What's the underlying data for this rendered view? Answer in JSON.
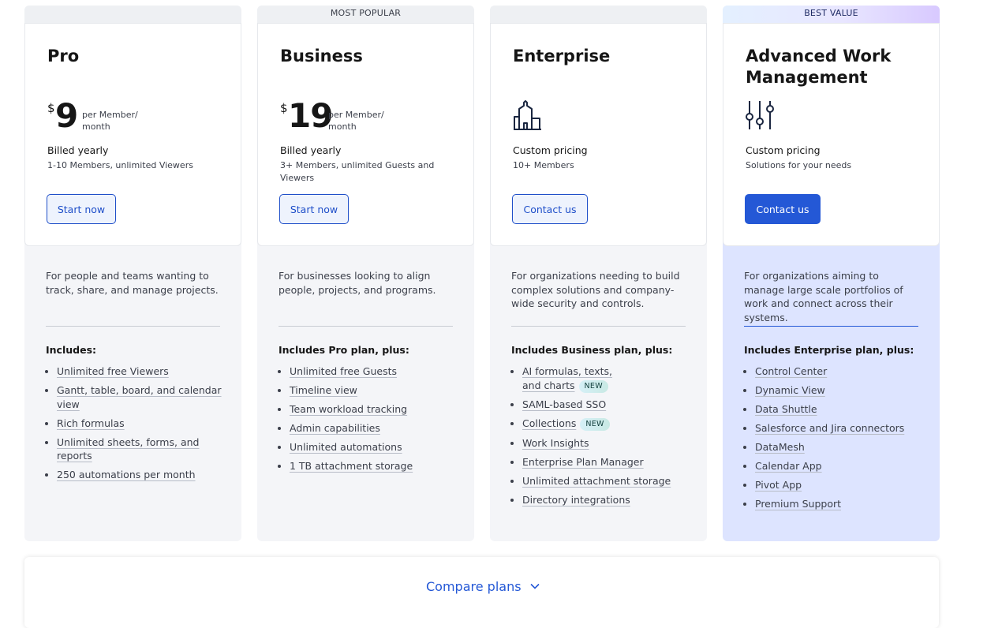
{
  "plans": [
    {
      "banner": "",
      "title": "Pro",
      "price": {
        "currency": "$",
        "amount": "9",
        "per": "per Member/ month"
      },
      "billing": "Billed yearly",
      "subtext": "1-10 Members, unlimited Viewers",
      "cta": "Start now",
      "description": "For people and teams wanting to track, share, and manage projects.",
      "includes_label": "Includes:",
      "features": [
        {
          "text": "Unlimited free Viewers"
        },
        {
          "text": "Gantt, table, board, and calendar view"
        },
        {
          "text": "Rich formulas"
        },
        {
          "text": "Unlimited sheets, forms, and reports"
        },
        {
          "text": "250 automations per month"
        }
      ]
    },
    {
      "banner": "MOST POPULAR",
      "title": "Business",
      "price": {
        "currency": "$",
        "amount": "19",
        "per": "per Member/ month"
      },
      "billing": "Billed yearly",
      "subtext": "3+ Members, unlimited Guests and Viewers",
      "cta": "Start now",
      "description": "For businesses looking to align people, projects, and programs.",
      "includes_label": "Includes Pro plan, plus:",
      "features": [
        {
          "text": "Unlimited free Guests"
        },
        {
          "text": "Timeline view"
        },
        {
          "text": "Team workload tracking"
        },
        {
          "text": "Admin capabilities"
        },
        {
          "text": "Unlimited automations"
        },
        {
          "text": "1 TB attachment storage"
        }
      ]
    },
    {
      "banner": "",
      "title": "Enterprise",
      "icon": "building-icon",
      "billing": "Custom pricing",
      "subtext": "10+ Members",
      "cta": "Contact us",
      "description": "For organizations needing to build complex solutions and company-wide security and controls.",
      "includes_label": "Includes Business plan, plus:",
      "features": [
        {
          "text": "AI formulas, texts, and charts",
          "badge": "NEW"
        },
        {
          "text": "SAML-based SSO"
        },
        {
          "text": "Collections",
          "badge": "NEW"
        },
        {
          "text": "Work Insights"
        },
        {
          "text": "Enterprise Plan Manager"
        },
        {
          "text": "Unlimited attachment storage"
        },
        {
          "text": "Directory integrations"
        }
      ]
    },
    {
      "banner": "BEST VALUE",
      "title": "Advanced Work Management",
      "icon": "sliders-icon",
      "billing": "Custom pricing",
      "subtext": "Solutions for your needs",
      "cta": "Contact us",
      "description": "For organizations aiming to manage large scale portfolios of work and connect across their systems.",
      "includes_label": "Includes Enterprise plan, plus:",
      "features": [
        {
          "text": "Control Center"
        },
        {
          "text": "Dynamic View"
        },
        {
          "text": "Data Shuttle"
        },
        {
          "text": "Salesforce and Jira connectors"
        },
        {
          "text": "DataMesh"
        },
        {
          "text": "Calendar App"
        },
        {
          "text": "Pivot App"
        },
        {
          "text": "Premium Support"
        }
      ]
    }
  ],
  "compare": {
    "label": "Compare plans",
    "icon": "chevron-down-icon"
  },
  "colors": {
    "accent": "#2458d6",
    "highlight_bg": "#dde4ff",
    "card_bg": "#f4f5f8"
  }
}
